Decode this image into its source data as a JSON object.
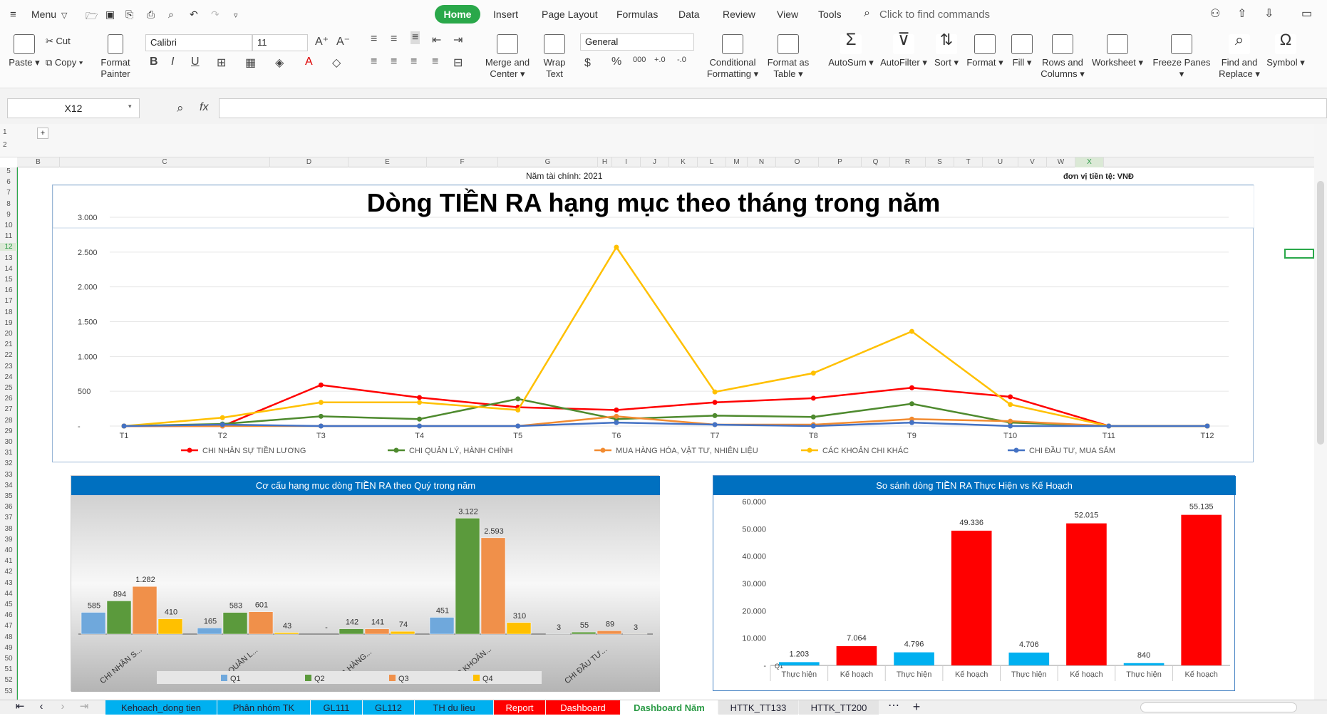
{
  "menubar": {
    "menu": "Menu",
    "tabs": [
      "Home",
      "Insert",
      "Page Layout",
      "Formulas",
      "Data",
      "Review",
      "View",
      "Tools"
    ],
    "search": "Click to find commands"
  },
  "ribbon": {
    "paste": "Paste",
    "cut": "Cut",
    "copy": "Copy",
    "format_painter_1": "Format",
    "format_painter_2": "Painter",
    "font": "Calibri",
    "size": "11",
    "bold": "B",
    "italic": "I",
    "underline": "U",
    "merge_1": "Merge and",
    "merge_2": "Center",
    "wrap_1": "Wrap",
    "wrap_2": "Text",
    "number_format": "General",
    "cond_1": "Conditional",
    "cond_2": "Formatting",
    "fat_1": "Format as",
    "fat_2": "Table",
    "autosum": "AutoSum",
    "autofilter": "AutoFilter",
    "sort": "Sort",
    "format": "Format",
    "fill": "Fill",
    "rows_1": "Rows and",
    "rows_2": "Columns",
    "worksheet": "Worksheet",
    "freeze": "Freeze Panes",
    "find_1": "Find and",
    "find_2": "Replace",
    "symbol": "Symbol"
  },
  "formula_bar": {
    "name_box": "X12",
    "fx": "fx"
  },
  "columns": [
    "B",
    "C",
    "D",
    "E",
    "F",
    "G",
    "H",
    "I",
    "J",
    "K",
    "L",
    "M",
    "N",
    "O",
    "P",
    "Q",
    "R",
    "S",
    "T",
    "U",
    "V",
    "W",
    "X"
  ],
  "rows": [
    "5",
    "6",
    "7",
    "8",
    "9",
    "10",
    "11",
    "12",
    "13",
    "14",
    "15",
    "16",
    "17",
    "18",
    "19",
    "20",
    "21",
    "22",
    "23",
    "24",
    "25",
    "26",
    "27",
    "28",
    "29",
    "30",
    "31",
    "32",
    "33",
    "34",
    "35",
    "36",
    "37",
    "38",
    "39",
    "40",
    "41",
    "42",
    "43",
    "44",
    "45",
    "46",
    "47",
    "48",
    "49",
    "50",
    "51",
    "52",
    "53"
  ],
  "sheet_text": {
    "fiscal_year": "Năm tài chính: 2021",
    "currency": "đơn vị tiền tệ: VNĐ"
  },
  "sheet_tabs": [
    "Kehoach_dong tien",
    "Phân nhóm TK",
    "GL111",
    "GL112",
    "TH du lieu",
    "Report",
    "Dashboard",
    "Dashboard Năm",
    "HTTK_TT133",
    "HTTK_TT200"
  ],
  "chart_data": [
    {
      "type": "line",
      "title": "Dòng TIỀN RA hạng mục theo tháng trong năm",
      "categories": [
        "T1",
        "T2",
        "T3",
        "T4",
        "T5",
        "T6",
        "T7",
        "T8",
        "T9",
        "T10",
        "T11",
        "T12"
      ],
      "yticks": [
        "-",
        "500",
        "1.000",
        "1.500",
        "2.000",
        "2.500",
        "3.000"
      ],
      "ylim": [
        0,
        3000
      ],
      "legend": "bottom",
      "series": [
        {
          "name": "CHI NHÂN SỰ TIỀN LƯƠNG",
          "color": "#ff0000",
          "values": [
            0,
            0,
            590,
            410,
            270,
            230,
            340,
            400,
            550,
            420,
            0,
            0
          ]
        },
        {
          "name": "CHI QUẢN LÝ, HÀNH CHÍNH",
          "color": "#4e8a2e",
          "values": [
            0,
            30,
            140,
            100,
            390,
            100,
            150,
            130,
            320,
            50,
            0,
            0
          ]
        },
        {
          "name": "MUA HÀNG HÓA, VẬT TƯ, NHIÊN LIỆU",
          "color": "#f28b30",
          "values": [
            0,
            0,
            0,
            0,
            0,
            140,
            20,
            20,
            100,
            70,
            0,
            0
          ]
        },
        {
          "name": "CÁC KHOẢN CHI KHÁC",
          "color": "#ffc000",
          "values": [
            0,
            120,
            340,
            340,
            230,
            2570,
            490,
            760,
            1360,
            310,
            0,
            0
          ]
        },
        {
          "name": "CHI ĐẦU TƯ, MUA SẮM",
          "color": "#4472c4",
          "values": [
            0,
            20,
            0,
            0,
            0,
            50,
            20,
            0,
            50,
            0,
            0,
            0
          ]
        }
      ]
    },
    {
      "type": "bar",
      "title": "Cơ cấu hạng mục dòng TIỀN RA theo Quý trong năm",
      "categories": [
        "CHI NHÂN S...",
        "CHI QUẢN L...",
        "MUA HÀNG...",
        "CÁC KHOẢN...",
        "CHI ĐẦU TƯ..."
      ],
      "ylim": [
        0,
        3300
      ],
      "series": [
        {
          "name": "Q1",
          "color": "#6fa8dc",
          "values": [
            585,
            165,
            0,
            451,
            3
          ],
          "labels": [
            "585",
            "165",
            "-",
            "451",
            "3"
          ]
        },
        {
          "name": "Q2",
          "color": "#5b9a3c",
          "values": [
            894,
            583,
            142,
            3122,
            55
          ],
          "labels": [
            "894",
            "583",
            "142",
            "3.122",
            "55"
          ]
        },
        {
          "name": "Q3",
          "color": "#f0904a",
          "values": [
            1282,
            601,
            141,
            2593,
            89
          ],
          "labels": [
            "1.282",
            "601",
            "141",
            "2.593",
            "89"
          ]
        },
        {
          "name": "Q4",
          "color": "#ffc000",
          "values": [
            410,
            43,
            74,
            310,
            3
          ],
          "labels": [
            "410",
            "43",
            "74",
            "310",
            "3"
          ]
        }
      ]
    },
    {
      "type": "bar",
      "title": "So sánh dòng TIỀN RA Thực Hiện vs Kế Hoạch",
      "categories": [
        "Thực hiện",
        "Kế hoạch",
        "Thực hiện",
        "Kế hoạch",
        "Thực hiện",
        "Kế hoạch",
        "Thực hiện",
        "Kế hoạch"
      ],
      "yticks": [
        "-",
        "10.000",
        "20.000",
        "30.000",
        "40.000",
        "50.000",
        "60.000"
      ],
      "ylim": [
        0,
        60000
      ],
      "zero_label": "Q1",
      "values": [
        1203,
        7064,
        4796,
        49336,
        4706,
        52015,
        840,
        55135
      ],
      "labels": [
        "1.203",
        "7.064",
        "4.796",
        "49.336",
        "4.706",
        "52.015",
        "840",
        "55.135"
      ],
      "colors": [
        "#00b0f0",
        "#ff0000",
        "#00b0f0",
        "#ff0000",
        "#00b0f0",
        "#ff0000",
        "#00b0f0",
        "#ff0000"
      ]
    }
  ]
}
